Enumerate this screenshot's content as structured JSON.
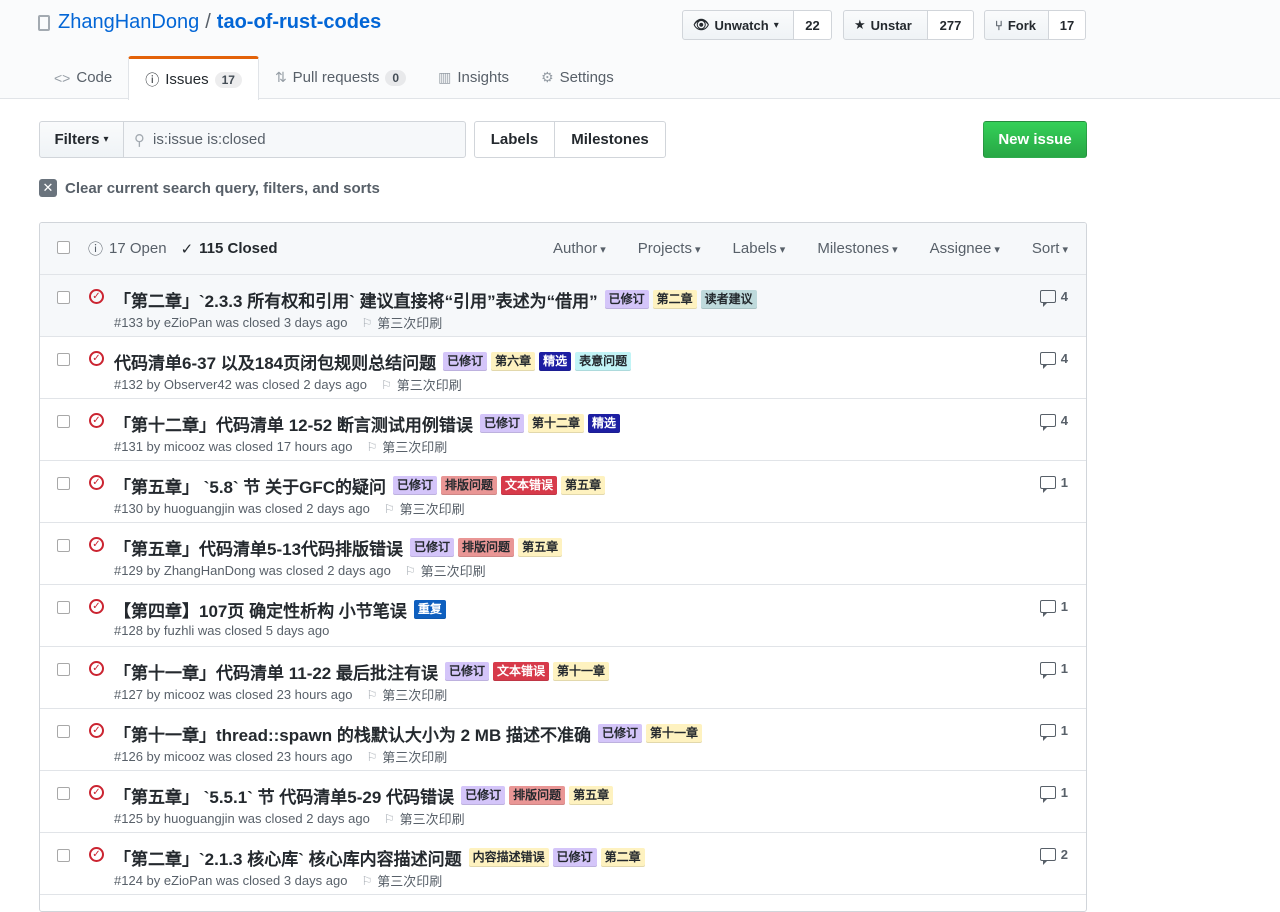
{
  "repo": {
    "owner": "ZhangHanDong",
    "separator": "/",
    "name": "tao-of-rust-codes"
  },
  "actions": {
    "watch": {
      "label": "Unwatch",
      "count": "22"
    },
    "star": {
      "label": "Unstar",
      "count": "277"
    },
    "fork": {
      "label": "Fork",
      "count": "17"
    }
  },
  "tabs": [
    {
      "label": "Code"
    },
    {
      "label": "Issues",
      "count": "17"
    },
    {
      "label": "Pull requests",
      "count": "0"
    },
    {
      "label": "Insights"
    },
    {
      "label": "Settings"
    }
  ],
  "toolbar": {
    "filters_label": "Filters",
    "search_value": "is:issue is:closed",
    "labels_label": "Labels",
    "milestones_label": "Milestones",
    "new_issue_label": "New issue"
  },
  "clear_label": "Clear current search query, filters, and sorts",
  "list_header": {
    "open": "17 Open",
    "closed": "115 Closed",
    "menus": [
      "Author",
      "Projects",
      "Labels",
      "Milestones",
      "Assignee",
      "Sort"
    ]
  },
  "label_colors": {
    "已修订": {
      "bg": "#d4c5f9",
      "fg": "#24292e"
    },
    "第二章": {
      "bg": "#fef2c0",
      "fg": "#24292e"
    },
    "读者建议": {
      "bg": "#bfdadc",
      "fg": "#24292e"
    },
    "第六章": {
      "bg": "#fef2c0",
      "fg": "#24292e"
    },
    "精选": {
      "bg": "#1d1ea2",
      "fg": "#ffffff"
    },
    "表意问题": {
      "bg": "#c2f4f6",
      "fg": "#24292e"
    },
    "第十二章": {
      "bg": "#fef2c0",
      "fg": "#24292e"
    },
    "排版问题": {
      "bg": "#e99695",
      "fg": "#24292e"
    },
    "文本错误": {
      "bg": "#d73a4a",
      "fg": "#ffffff"
    },
    "第五章": {
      "bg": "#fef2c0",
      "fg": "#24292e"
    },
    "重复": {
      "bg": "#0e5fbf",
      "fg": "#ffffff"
    },
    "第十一章": {
      "bg": "#fef2c0",
      "fg": "#24292e"
    },
    "内容描述错误": {
      "bg": "#fef2c0",
      "fg": "#24292e"
    }
  },
  "issues": [
    {
      "title": "「第二章」`2.3.3 所有权和引用` 建议直接将“引用”表述为“借用”",
      "labels": [
        "已修订",
        "第二章",
        "读者建议"
      ],
      "meta": "#133 by eZioPan was closed 3 days ago",
      "milestone": "第三次印刷",
      "comments": "4"
    },
    {
      "title": "代码清单6-37 以及184页闭包规则总结问题",
      "labels": [
        "已修订",
        "第六章",
        "精选",
        "表意问题"
      ],
      "meta": "#132 by Observer42 was closed 2 days ago",
      "milestone": "第三次印刷",
      "comments": "4"
    },
    {
      "title": "「第十二章」代码清单 12-52 断言测试用例错误",
      "labels": [
        "已修订",
        "第十二章",
        "精选"
      ],
      "meta": "#131 by micooz was closed 17 hours ago",
      "milestone": "第三次印刷",
      "comments": "4"
    },
    {
      "title": "「第五章」 `5.8` 节 关于GFC的疑问",
      "labels": [
        "已修订",
        "排版问题",
        "文本错误",
        "第五章"
      ],
      "meta": "#130 by huoguangjin was closed 2 days ago",
      "milestone": "第三次印刷",
      "comments": "1"
    },
    {
      "title": "「第五章」代码清单5-13代码排版错误",
      "labels": [
        "已修订",
        "排版问题",
        "第五章"
      ],
      "meta": "#129 by ZhangHanDong was closed 2 days ago",
      "milestone": "第三次印刷",
      "comments": ""
    },
    {
      "title": "【第四章】107页 确定性析构 小节笔误",
      "labels": [
        "重复"
      ],
      "meta": "#128 by fuzhli was closed 5 days ago",
      "milestone": "",
      "comments": "1"
    },
    {
      "title": "「第十一章」代码清单 11-22 最后批注有误",
      "labels": [
        "已修订",
        "文本错误",
        "第十一章"
      ],
      "meta": "#127 by micooz was closed 23 hours ago",
      "milestone": "第三次印刷",
      "comments": "1"
    },
    {
      "title": "「第十一章」thread::spawn 的栈默认大小为 2 MB 描述不准确",
      "labels": [
        "已修订",
        "第十一章"
      ],
      "meta": "#126 by micooz was closed 23 hours ago",
      "milestone": "第三次印刷",
      "comments": "1"
    },
    {
      "title": "「第五章」 `5.5.1` 节 代码清单5-29 代码错误",
      "labels": [
        "已修订",
        "排版问题",
        "第五章"
      ],
      "meta": "#125 by huoguangjin was closed 2 days ago",
      "milestone": "第三次印刷",
      "comments": "1"
    },
    {
      "title": "「第二章」`2.1.3 核心库` 核心库内容描述问题",
      "labels": [
        "内容描述错误",
        "已修订",
        "第二章"
      ],
      "meta": "#124 by eZioPan was closed 3 days ago",
      "milestone": "第三次印刷",
      "comments": "2"
    }
  ]
}
